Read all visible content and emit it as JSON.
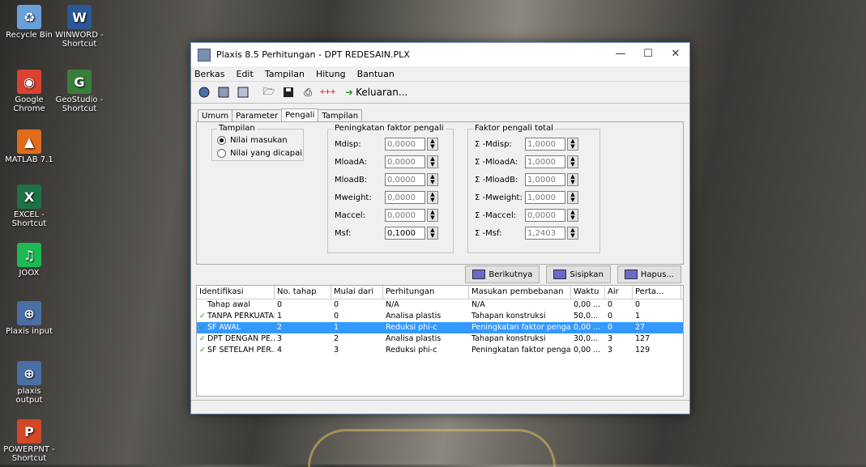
{
  "desktop": {
    "icons": [
      {
        "label": "Recycle Bin",
        "color": "#6aa0d8",
        "glyph": "recycle-bin-icon",
        "sym": "♻"
      },
      {
        "label": "WINWORD - Shortcut",
        "color": "#2b5797",
        "glyph": "word-icon",
        "sym": "W"
      },
      {
        "label": "Google Chrome",
        "color": "#d9432f",
        "glyph": "chrome-icon",
        "sym": "◉"
      },
      {
        "label": "GeoStudio - Shortcut",
        "color": "#3a7d3a",
        "glyph": "geostudio-icon",
        "sym": "G"
      },
      {
        "label": "MATLAB 7.1",
        "color": "#e06b1d",
        "glyph": "matlab-icon",
        "sym": "▲"
      },
      {
        "label": "EXCEL - Shortcut",
        "color": "#1e7145",
        "glyph": "excel-icon",
        "sym": "X"
      },
      {
        "label": "JOOX",
        "color": "#1db954",
        "glyph": "joox-icon",
        "sym": "♫"
      },
      {
        "label": "Plaxis input",
        "color": "#4a6fa5",
        "glyph": "plaxis-input-icon",
        "sym": "⊕"
      },
      {
        "label": "plaxis output",
        "color": "#4a6fa5",
        "glyph": "plaxis-output-icon",
        "sym": "⊕"
      },
      {
        "label": "POWERPNT - Shortcut",
        "color": "#d24726",
        "glyph": "powerpoint-icon",
        "sym": "P"
      }
    ]
  },
  "window": {
    "title": "Plaxis 8.5 Perhitungan - DPT REDESAIN.PLX",
    "controls": {
      "minimize": "—",
      "maximize": "☐",
      "close": "✕"
    },
    "menu": [
      "Berkas",
      "Edit",
      "Tampilan",
      "Hitung",
      "Bantuan"
    ],
    "toolbar": {
      "keluaran": "Keluaran..."
    },
    "tabs": [
      "Umum",
      "Parameter",
      "Pengali",
      "Tampilan"
    ],
    "active_tab": "Pengali",
    "tampilan": {
      "title": "Tampilan",
      "options": [
        "Nilai masukan",
        "Nilai yang dicapai"
      ],
      "selected": "Nilai masukan"
    },
    "peningkatan": {
      "title": "Peningkatan faktor pengali",
      "rows": [
        {
          "label": "Mdisp:",
          "value": "0,0000"
        },
        {
          "label": "MloadA:",
          "value": "0,0000"
        },
        {
          "label": "MloadB:",
          "value": "0,0000"
        },
        {
          "label": "Mweight:",
          "value": "0,0000"
        },
        {
          "label": "Maccel:",
          "value": "0,0000"
        },
        {
          "label": "Msf:",
          "value": "0,1000"
        }
      ]
    },
    "total": {
      "title": "Faktor pengali total",
      "rows": [
        {
          "label": "Σ -Mdisp:",
          "value": "1,0000"
        },
        {
          "label": "Σ -MloadA:",
          "value": "1,0000"
        },
        {
          "label": "Σ -MloadB:",
          "value": "1,0000"
        },
        {
          "label": "Σ -Mweight:",
          "value": "1,0000"
        },
        {
          "label": "Σ -Maccel:",
          "value": "0,0000"
        },
        {
          "label": "Σ -Msf:",
          "value": "1,2403"
        }
      ]
    },
    "buttons": {
      "next": "Berikutnya",
      "insert": "Sisipkan",
      "delete": "Hapus..."
    },
    "table": {
      "headers": [
        "Identifikasi",
        "No. tahap",
        "Mulai dari",
        "Perhitungan",
        "Masukan pembebanan",
        "Waktu",
        "Air",
        "Perta..."
      ],
      "rows": [
        {
          "id": "Tahap awal",
          "no": "0",
          "start": "0",
          "calc": "N/A",
          "load": "N/A",
          "time": "0,00 ...",
          "air": "0",
          "perta": "0",
          "check": false,
          "selected": false
        },
        {
          "id": "TANPA PERKUATAN",
          "no": "1",
          "start": "0",
          "calc": "Analisa plastis",
          "load": "Tahapan konstruksi",
          "time": "50,0...",
          "air": "0",
          "perta": "1",
          "check": true,
          "selected": false
        },
        {
          "id": "SF AWAL",
          "no": "2",
          "start": "1",
          "calc": "Reduksi phi-c",
          "load": "Peningkatan faktor pengali",
          "time": "0,00 ...",
          "air": "0",
          "perta": "27",
          "check": true,
          "selected": true
        },
        {
          "id": "DPT DENGAN PE...",
          "no": "3",
          "start": "2",
          "calc": "Analisa plastis",
          "load": "Tahapan konstruksi",
          "time": "30,0...",
          "air": "3",
          "perta": "127",
          "check": true,
          "selected": false
        },
        {
          "id": "SF SETELAH PER...",
          "no": "4",
          "start": "3",
          "calc": "Reduksi phi-c",
          "load": "Peningkatan faktor pengali",
          "time": "0,00 ...",
          "air": "3",
          "perta": "129",
          "check": true,
          "selected": false
        }
      ]
    }
  }
}
